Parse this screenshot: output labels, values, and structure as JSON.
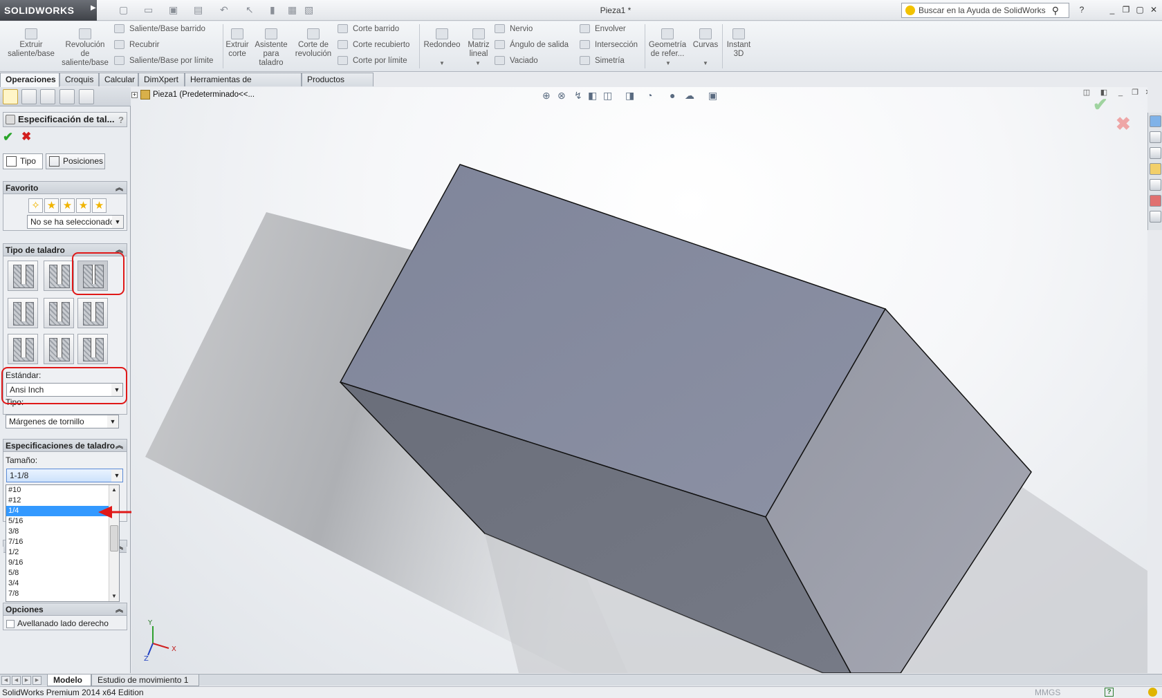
{
  "app": {
    "logo": "SOLIDWORKS",
    "document_title": "Pieza1 *",
    "search_placeholder": "Buscar en la Ayuda de SolidWorks"
  },
  "command_manager": {
    "big": [
      {
        "id": "extrude",
        "label": "Extruir\nsaliente/base"
      },
      {
        "id": "revolve",
        "label": "Revolución\nde\nsaliente/base"
      },
      {
        "id": "cut-extrude",
        "label": "Extruir\ncorte"
      },
      {
        "id": "hole-wizard",
        "label": "Asistente\npara\ntaladro"
      },
      {
        "id": "cut-revolve",
        "label": "Corte de\nrevolución"
      },
      {
        "id": "fillet",
        "label": "Redondeo"
      },
      {
        "id": "linear-pattern",
        "label": "Matriz\nlineal"
      },
      {
        "id": "ref-geometry",
        "label": "Geometría\nde refer..."
      },
      {
        "id": "curves",
        "label": "Curvas"
      },
      {
        "id": "instant3d",
        "label": "Instant\n3D"
      }
    ],
    "small": [
      {
        "id": "swept-boss",
        "label": "Saliente/Base barrido"
      },
      {
        "id": "loft",
        "label": "Recubrir"
      },
      {
        "id": "boundary-boss",
        "label": "Saliente/Base por límite"
      },
      {
        "id": "swept-cut",
        "label": "Corte barrido"
      },
      {
        "id": "lofted-cut",
        "label": "Corte recubierto"
      },
      {
        "id": "boundary-cut",
        "label": "Corte por límite"
      },
      {
        "id": "rib",
        "label": "Nervio"
      },
      {
        "id": "draft",
        "label": "Ángulo de salida"
      },
      {
        "id": "shell",
        "label": "Vaciado"
      },
      {
        "id": "wrap",
        "label": "Envolver"
      },
      {
        "id": "intersect",
        "label": "Intersección"
      },
      {
        "id": "mirror",
        "label": "Simetría"
      }
    ]
  },
  "tabs": [
    "Operaciones",
    "Croquis",
    "Calcular",
    "DimXpert",
    "Herramientas de renderizado",
    "Productos Office"
  ],
  "property_manager": {
    "title": "Especificación de tal...",
    "help": "?",
    "subtabs": [
      "Tipo",
      "Posiciones"
    ],
    "favorito": {
      "header": "Favorito",
      "combo": "No se ha seleccionado"
    },
    "tipo_taladro": {
      "header": "Tipo de taladro",
      "estandar_label": "Estándar:",
      "estandar_value": "Ansi Inch",
      "tipo_label": "Tipo:",
      "tipo_value": "Márgenes de tornillo"
    },
    "especificaciones": {
      "header": "Especificaciones de taladro",
      "tamano_label": "Tamaño:",
      "tamano_value": "1-1/8",
      "list": [
        "#10",
        "#12",
        "1/4",
        "5/16",
        "3/8",
        "7/16",
        "1/2",
        "9/16",
        "5/8",
        "3/4",
        "7/8"
      ],
      "selected_index": 2
    },
    "opciones": {
      "header": "Opciones",
      "checkbox_label": "Avellanado lado derecho"
    }
  },
  "tree": {
    "root": "Pieza1  (Predeterminado<<..."
  },
  "triad": {
    "x": "X",
    "y": "Y",
    "z": "Z"
  },
  "model_tabs": [
    "Modelo",
    "Estudio de movimiento 1"
  ],
  "status": {
    "text": "SolidWorks Premium 2014 x64 Edition",
    "units": "MMGS",
    "help": "?"
  },
  "colors": {
    "highlight": "#e01818",
    "selection": "#3399ff",
    "top_face": "#858ba0",
    "right_face": "#9ea1ad",
    "front_face": "#6f737f"
  }
}
